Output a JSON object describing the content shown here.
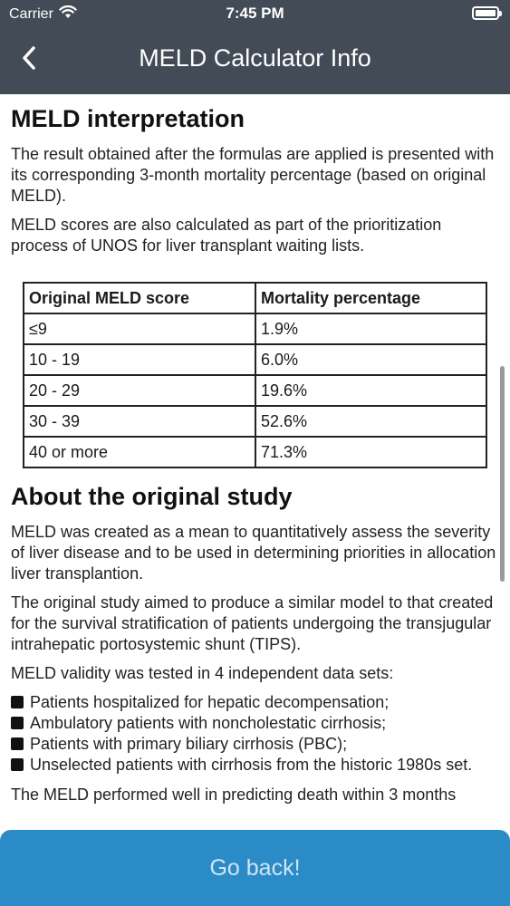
{
  "status_bar": {
    "carrier": "Carrier",
    "time": "7:45 PM"
  },
  "nav": {
    "title": "MELD Calculator Info"
  },
  "section1": {
    "heading": "MELD interpretation",
    "paragraphs": [
      "The result obtained after the formulas are applied is presented with its corresponding 3-month mortality percentage (based on original MELD).",
      "MELD scores are also calculated as part of the prioritization process of UNOS for liver transplant waiting lists."
    ]
  },
  "table": {
    "headers": [
      "Original MELD score",
      "Mortality percentage"
    ],
    "rows": [
      [
        "≤9",
        "1.9%"
      ],
      [
        "10 - 19",
        "6.0%"
      ],
      [
        "20 - 29",
        "19.6%"
      ],
      [
        "30 - 39",
        "52.6%"
      ],
      [
        "40 or more",
        "71.3%"
      ]
    ]
  },
  "section2": {
    "heading": "About the original study",
    "paragraphs": [
      "MELD was created as a mean to quantitatively assess the severity of liver disease and to be used in determining priorities in allocation liver transplantion.",
      "The original study aimed to produce a similar model to that created for the survival stratification of patients undergoing the transjugular intrahepatic portosystemic shunt (TIPS).",
      "MELD validity was tested in 4 independent data sets:"
    ],
    "bullets": [
      "Patients hospitalized for hepatic decompensation;",
      "Ambulatory patients with noncholestatic cirrhosis;",
      "Patients with primary biliary cirrhosis (PBC);",
      "Unselected patients with cirrhosis from the historic 1980s set."
    ],
    "trailing": "The MELD performed well in predicting death within 3 months"
  },
  "footer": {
    "go_back_label": "Go back!"
  },
  "colors": {
    "header_bg": "#424b56",
    "button_bg": "#2b8bc6",
    "button_text": "#cfe6f5"
  },
  "icons": [
    "wifi-icon",
    "battery-icon",
    "chevron-left-icon",
    "square-bullet-icon"
  ]
}
